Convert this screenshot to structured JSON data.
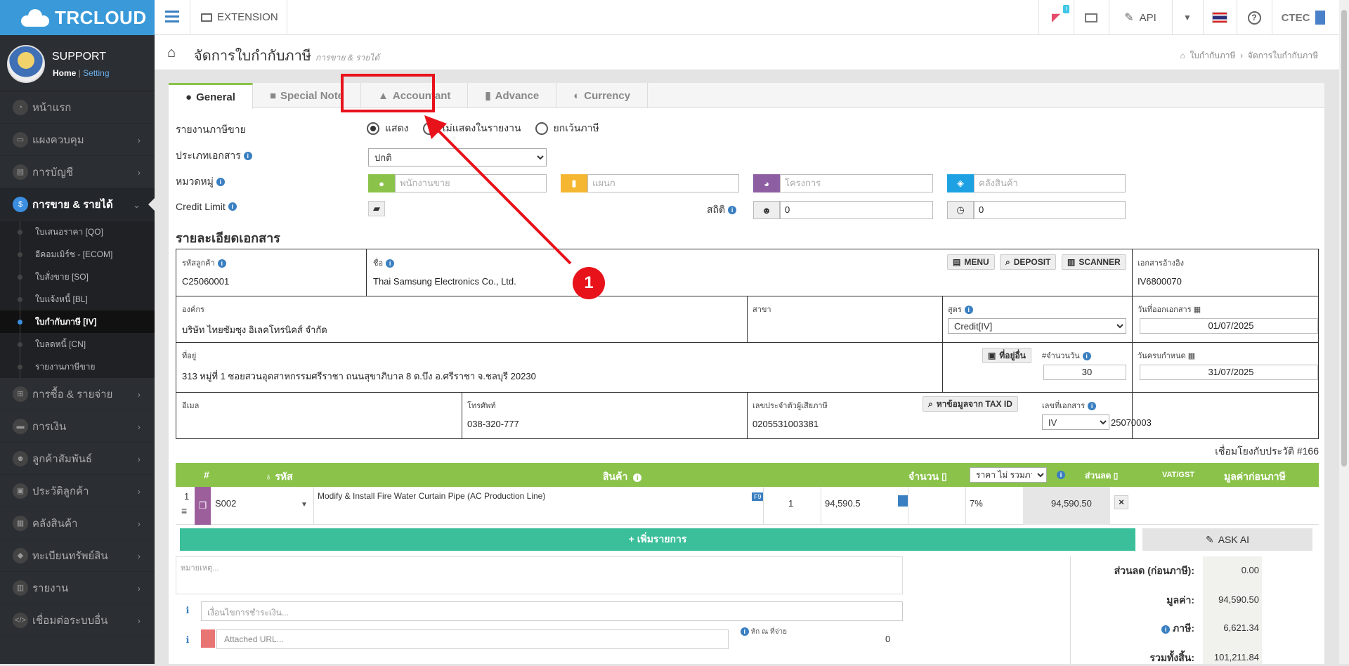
{
  "app": {
    "logo_text": "TRCLOUD"
  },
  "topbar": {
    "extension_label": "EXTENSION",
    "notif_badge": "!",
    "api_label": "API",
    "company": "CTEC"
  },
  "sidebar": {
    "profile_name": "SUPPORT",
    "home_link": "Home",
    "separator": "|",
    "setting_link": "Setting",
    "items": [
      {
        "label": "หน้าแรก",
        "icon": "dashboard-icon"
      },
      {
        "label": "แผงควบคุม",
        "icon": "monitor-icon"
      },
      {
        "label": "การบัญชี",
        "icon": "book-icon"
      },
      {
        "label": "การขาย & รายได้",
        "icon": "dollar-icon"
      },
      {
        "label": "การซื้อ & รายจ่าย",
        "icon": "cart-icon"
      },
      {
        "label": "การเงิน",
        "icon": "money-icon"
      },
      {
        "label": "ลูกค้าสัมพันธ์",
        "icon": "users-icon"
      },
      {
        "label": "ประวัติลูกค้า",
        "icon": "profile-icon"
      },
      {
        "label": "คลังสินค้า",
        "icon": "cubes-icon"
      },
      {
        "label": "ทะเบียนทรัพย์สิน",
        "icon": "diamond-icon"
      },
      {
        "label": "รายงาน",
        "icon": "report-icon"
      },
      {
        "label": "เชื่อมต่อระบบอื่น",
        "icon": "code-icon"
      }
    ],
    "sub_items": [
      "ใบเสนอราคา [QO]",
      "อีคอมเมิร์ช - [ECOM]",
      "ใบสั่งขาย [SO]",
      "ใบแจ้งหนี้ [BL]",
      "ใบกำกับภาษี [IV]",
      "ใบลดหนี้ [CN]",
      "รายงานภาษีขาย"
    ]
  },
  "header": {
    "title": "จัดการใบกำกับภาษี",
    "subtitle": "การขาย & รายได้",
    "breadcrumb_1": "ใบกำกับภาษี",
    "breadcrumb_sep": "›",
    "breadcrumb_2": "จัดการใบกำกับภาษี"
  },
  "tabs": [
    "General",
    "Special Note",
    "Accountant",
    "Advance",
    "Currency"
  ],
  "form": {
    "sales_report_label": "รายงานภาษีขาย",
    "radio_1": "แสดง",
    "radio_2": "ไม่แสดงในรายงาน",
    "radio_3": "ยกเว้นภาษี",
    "doc_type_label": "ประเภทเอกสาร",
    "doc_type_value": "ปกติ",
    "category_label": "หมวดหมู่",
    "salesperson_placeholder": "พนักงานขาย",
    "department_placeholder": "แผนก",
    "project_placeholder": "โครงการ",
    "warehouse_placeholder": "คลังสินค้า",
    "credit_limit_label": "Credit Limit",
    "stats_label": "สถิติ",
    "stats_value_1": "0",
    "stats_value_2": "0"
  },
  "doc": {
    "section_title": "รายละเอียดเอกสาร",
    "customer_code_label": "รหัสลูกค้า",
    "customer_code": "C25060001",
    "name_label": "ชื่อ",
    "name": "Thai Samsung Electronics Co., Ltd.",
    "menu_btn": "MENU",
    "deposit_btn": "DEPOSIT",
    "scanner_btn": "SCANNER",
    "ref_label": "เอกสารอ้างอิง",
    "ref_value": "IV6800070",
    "org_label": "องค์กร",
    "org_value": "บริษัท ไทยซัมซุง อิเลคโทรนิคส์ จำกัด",
    "branch_label": "สาขา",
    "formula_label": "สูตร",
    "formula_value": "Credit[IV]",
    "issue_date_label": "วันที่ออกเอกสาร",
    "issue_date": "01/07/2025",
    "address_label": "ที่อยู่",
    "address": "313  หมู่ที่ 1 ซอยสวนอุตสาหกรรมศรีราชา ถนนสุขาภิบาล 8 ต.บึง อ.ศรีราชา จ.ชลบุรี 20230",
    "other_address_btn": "ที่อยู่อื่น",
    "days_label": "#จำนวนวัน",
    "days_value": "30",
    "due_date_label": "วันครบกำหนด",
    "due_date": "31/07/2025",
    "email_label": "อีเมล",
    "phone_label": "โทรศัพท์",
    "phone": "038-320-777",
    "tax_id_label": "เลขประจำตัวผู้เสียภาษี",
    "tax_id": "0205531003381",
    "tax_lookup_btn": "หาข้อมูลจาก TAX ID",
    "doc_no_label": "เลขที่เอกสาร",
    "doc_prefix": "IV",
    "doc_no": "25070003",
    "linked_text": "เชื่อมโยงกับประวัติ #166"
  },
  "table": {
    "col_no": "#",
    "col_code": "รหัส",
    "col_product": "สินค้า",
    "col_qty": "จำนวน",
    "col_price_mode": "ราคา ไม่ รวมภาษี",
    "col_discount": "ส่วนลด",
    "col_vat": "VAT/GST",
    "col_amount": "มูลค่าก่อนภาษี",
    "rows": [
      {
        "no": "1",
        "code": "S002",
        "product": "Modify & Install Fire Water Curtain Pipe (AC Production Line)",
        "tag": "F9",
        "qty": "1",
        "price": "94,590.5",
        "vat": "7%",
        "amount": "94,590.50"
      }
    ],
    "add_btn": "+ เพิ่มรายการ",
    "ai_btn": "ASK AI"
  },
  "footer": {
    "note_placeholder": "หมายเหตุ...",
    "payment_placeholder": "เงื่อนไขการชำระเงิน...",
    "attach_placeholder": "Attached URL...",
    "withholding_label": "หัก ณ ที่จ่าย",
    "withholding_value": "0",
    "discount_label": "ส่วนลด (ก่อนภาษี):",
    "discount_value": "0.00",
    "value_label": "มูลค่า:",
    "value_value": "94,590.50",
    "tax_label": "ภาษี:",
    "tax_value": "6,621.34",
    "total_label": "รวมทั้งสิ้น:",
    "total_value": "101,211.84"
  },
  "annotation": {
    "marker": "1",
    "color": "#e8121b"
  }
}
